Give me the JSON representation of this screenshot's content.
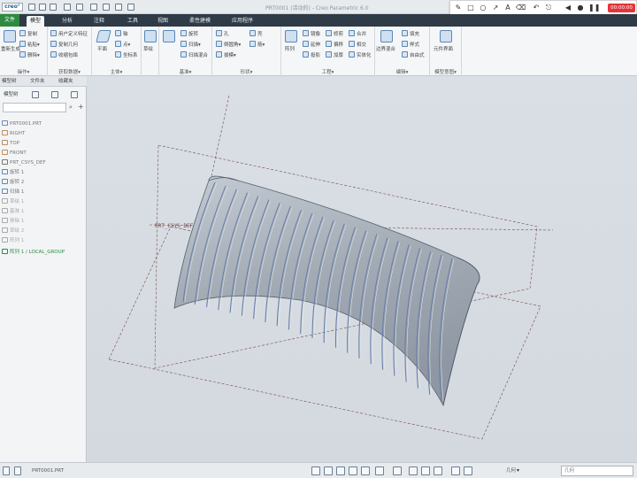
{
  "window": {
    "logo": "creo°",
    "title": "PRT0001 (活动的) - Creo Parametric 6.0"
  },
  "recorder": {
    "timer": "00:00:00",
    "accent": "#e5343a"
  },
  "menu": {
    "tabs": [
      {
        "label": "文件"
      },
      {
        "label": "模型"
      },
      {
        "label": "分析"
      },
      {
        "label": "注释"
      },
      {
        "label": "工具"
      },
      {
        "label": "视图"
      },
      {
        "label": "柔性建模"
      },
      {
        "label": "应用程序"
      }
    ]
  },
  "ribbon": {
    "groups": [
      {
        "label": "操作▾",
        "items": [
          "重新生成",
          "复制",
          "粘贴▾",
          "删除▾"
        ]
      },
      {
        "label": "获取数据▾",
        "items": [
          "用户定义特征",
          "复制几何",
          "收缩包络"
        ]
      },
      {
        "label": "主体▾",
        "items": [
          "平面",
          "轴",
          "点▾",
          "坐标系",
          "草绘"
        ]
      },
      {
        "label": "基准▾",
        "items": [
          "旋转",
          "扫描▾",
          "扫描混合"
        ]
      },
      {
        "label": "形状▾",
        "items": [
          "孔",
          "倒圆角▾",
          "拔模▾",
          "壳",
          "筋▾"
        ]
      },
      {
        "label": "工程▾",
        "items": [
          "阵列",
          "镜像",
          "延伸",
          "投影",
          "修剪",
          "偏移",
          "加厚",
          "合并",
          "相交",
          "实体化"
        ]
      },
      {
        "label": "编辑▾",
        "items": [
          "边界混合",
          "填充",
          "样式",
          "自由式"
        ]
      },
      {
        "label": "曲面▾",
        "items": []
      },
      {
        "label": "模型意图▾",
        "items": [
          "元件界面"
        ]
      }
    ]
  },
  "panel": {
    "tabs": [
      "模型树",
      "文件夹",
      "收藏夹"
    ],
    "toolbar_label": "模型树",
    "search_placeholder": "",
    "tree": [
      {
        "label": "PRT0001.PRT",
        "dim": false
      },
      {
        "label": "RIGHT",
        "dim": false
      },
      {
        "label": "TOP",
        "dim": false
      },
      {
        "label": "FRONT",
        "dim": false
      },
      {
        "label": "PRT_CSYS_DEF",
        "dim": false
      },
      {
        "label": "旋转 1",
        "dim": false
      },
      {
        "label": "旋转 2",
        "dim": false
      },
      {
        "label": "扫描 1",
        "dim": false
      },
      {
        "label": "草绘 1",
        "dim": true
      },
      {
        "label": "基准 1",
        "dim": true
      },
      {
        "label": "移除 1",
        "dim": true
      },
      {
        "label": "草绘 2",
        "dim": true
      },
      {
        "label": "阵列 1",
        "dim": true
      },
      {
        "label": "阵列 1 / LOCAL_GROUP",
        "dim": false
      }
    ]
  },
  "viewport": {
    "csys_label": "PRT_CSYS_DEF",
    "model_color": "#a3abb5",
    "groove_color": "#6a7fa8"
  },
  "statusbar": {
    "item_label": "PRT0001.PRT",
    "selection_mode": "几何",
    "filter": "几何"
  }
}
